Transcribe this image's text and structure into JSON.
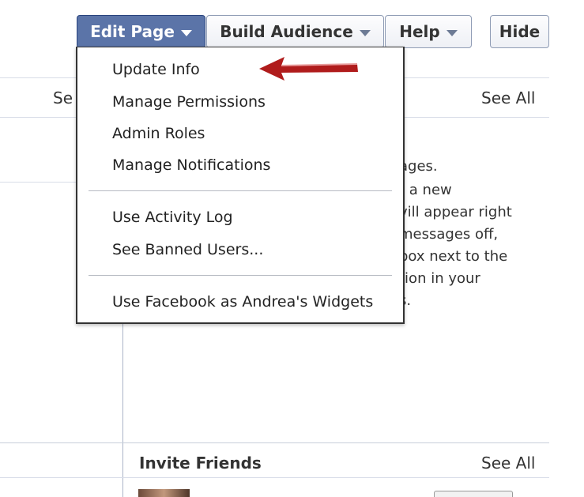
{
  "toolbar": {
    "edit_page_label": "Edit Page",
    "build_audience_label": "Build Audience",
    "help_label": "Help",
    "hide_label": "Hide"
  },
  "panels": {
    "left_top_see_all_partial": "Se",
    "right_top_see_all": "See All",
    "messages_lines": [
      "ages.",
      "t a new",
      "vill appear right",
      " messages off,",
      "box next to the",
      "tion in your",
      "s."
    ],
    "invite_friends_title": "Invite Friends",
    "invite_see_all": "See All"
  },
  "dropdown": {
    "items": [
      "Update Info",
      "Manage Permissions",
      "Admin Roles",
      "Manage Notifications",
      "Use Activity Log",
      "See Banned Users...",
      "Use Facebook as Andrea's Widgets"
    ]
  },
  "colors": {
    "active_button": "#5b74a8",
    "arrow": "#b01c1c",
    "border": "#d8dde8"
  }
}
